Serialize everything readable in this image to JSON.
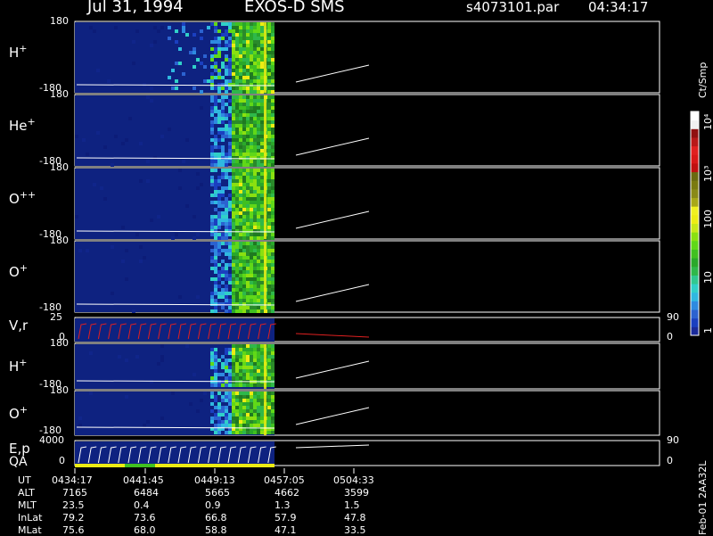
{
  "header": {
    "date": "Jul 31, 1994",
    "instrument": "EXOS-D SMS",
    "file": "s4073101.par",
    "time": "04:34:17"
  },
  "panels": [
    {
      "key": "h1",
      "label": "H",
      "sup": "+",
      "ytop": "180",
      "ybot": "-180"
    },
    {
      "key": "he",
      "label": "He",
      "sup": "+",
      "ytop": "180",
      "ybot": "-180"
    },
    {
      "key": "opp",
      "label": "O",
      "sup": "++",
      "ytop": "180",
      "ybot": "-180"
    },
    {
      "key": "o1",
      "label": "O",
      "sup": "+",
      "ytop": "180",
      "ybot": "-180"
    },
    {
      "key": "vr",
      "label": "V,r",
      "sup": "",
      "ytop": "25",
      "ybot": "0",
      "rtop": "90",
      "rbot": "0"
    },
    {
      "key": "h2",
      "label": "H",
      "sup": "+",
      "ytop": "180",
      "ybot": "-180"
    },
    {
      "key": "o2",
      "label": "O",
      "sup": "+",
      "ytop": "180",
      "ybot": "-180"
    },
    {
      "key": "ep",
      "label": "E,p",
      "sup": "",
      "ytop": "4000",
      "ybot": "0",
      "rtop": "90",
      "rbot": "0"
    }
  ],
  "qa_label": "QA",
  "colorbar": {
    "unit": "Ct/Smp",
    "ticks": [
      "10⁴",
      "10³",
      "100",
      "10",
      "1"
    ],
    "colors": [
      "#1a2a9a",
      "#1a3fc0",
      "#2b62d0",
      "#2e8ae0",
      "#2fb8e0",
      "#30d0c8",
      "#30c890",
      "#2fb84a",
      "#29a82a",
      "#40c020",
      "#60d818",
      "#8ae010",
      "#c8e818",
      "#ecec14",
      "#f0f020",
      "#a8a818",
      "#8a8a18",
      "#7a7a10",
      "#6a6a10",
      "#c01010",
      "#d81818",
      "#e02020",
      "#b81818",
      "#901010",
      "#f0f0f0",
      "#ffffff"
    ]
  },
  "ephemeris": {
    "labels": [
      "UT",
      "ALT",
      "MLT",
      "InLat",
      "MLat"
    ],
    "columns": [
      [
        "0434:17",
        "7165",
        "23.5",
        "79.2",
        "75.6"
      ],
      [
        "0441:45",
        "6484",
        "0.4",
        "73.6",
        "68.0"
      ],
      [
        "0449:13",
        "5665",
        "0.9",
        "66.8",
        "58.8"
      ],
      [
        "0457:05",
        "4662",
        "1.3",
        "57.9",
        "47.1"
      ],
      [
        "0504:33",
        "3599",
        "1.5",
        "47.8",
        "33.5"
      ]
    ]
  },
  "footer": "Feb-01 2AA32L"
}
